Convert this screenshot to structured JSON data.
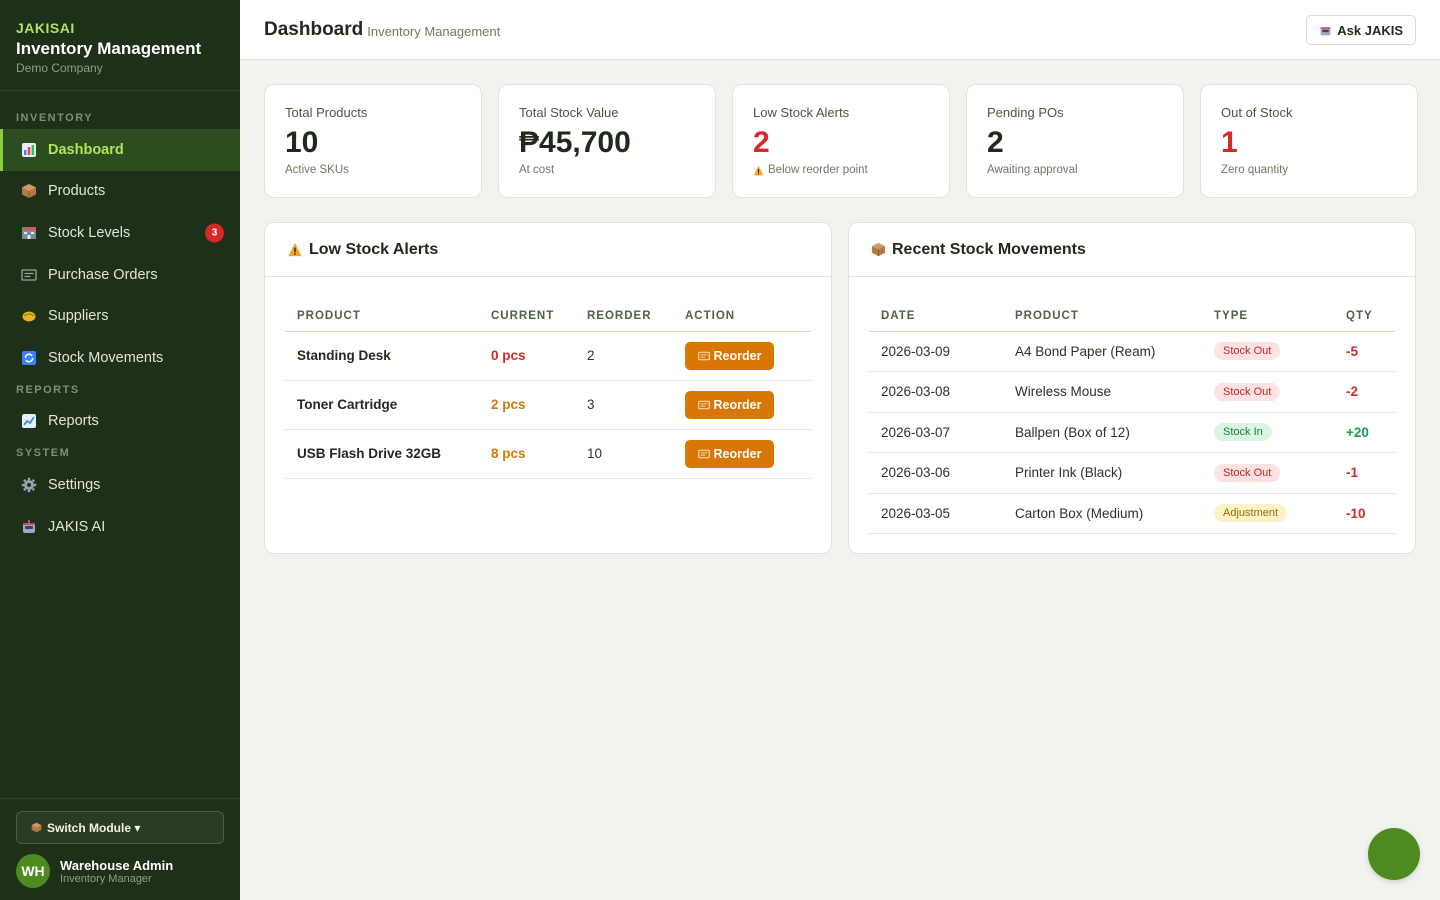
{
  "brand": {
    "tag": "JAKISAI",
    "title": "Inventory Management",
    "company": "Demo Company"
  },
  "sidebar": {
    "sections": {
      "inventory": "INVENTORY",
      "reports": "REPORTS",
      "system": "SYSTEM"
    },
    "items": [
      {
        "label": "Dashboard",
        "icon": "bar-chart-icon"
      },
      {
        "label": "Products",
        "icon": "package-icon"
      },
      {
        "label": "Stock Levels",
        "icon": "shelf-icon",
        "badge": "3"
      },
      {
        "label": "Purchase Orders",
        "icon": "order-icon"
      },
      {
        "label": "Suppliers",
        "icon": "handshake-icon"
      },
      {
        "label": "Stock Movements",
        "icon": "refresh-icon"
      },
      {
        "label": "Reports",
        "icon": "line-chart-icon"
      },
      {
        "label": "Settings",
        "icon": "gear-icon"
      },
      {
        "label": "JAKIS AI",
        "icon": "robot-icon"
      }
    ],
    "switch_module": "Switch Module ▾",
    "user": {
      "initials": "WH",
      "name": "Warehouse Admin",
      "role": "Inventory Manager"
    }
  },
  "header": {
    "title": "Dashboard",
    "subtitle": "Inventory Management",
    "ask_label": "Ask JAKIS"
  },
  "stats": [
    {
      "label": "Total Products",
      "value": "10",
      "sub": "Active SKUs"
    },
    {
      "label": "Total Stock Value",
      "value": "₱45,700",
      "sub": "At cost"
    },
    {
      "label": "Low Stock Alerts",
      "value": "2",
      "sub": "Below reorder point"
    },
    {
      "label": "Pending POs",
      "value": "2",
      "sub": "Awaiting approval"
    },
    {
      "label": "Out of Stock",
      "value": "1",
      "sub": "Zero quantity"
    }
  ],
  "low_stock": {
    "title": "Low Stock Alerts",
    "columns": [
      "PRODUCT",
      "CURRENT",
      "REORDER",
      "ACTION"
    ],
    "rows": [
      {
        "product": "Standing Desk",
        "current": "0 pcs",
        "reorder": "2",
        "action": "Reorder"
      },
      {
        "product": "Toner Cartridge",
        "current": "2 pcs",
        "reorder": "3",
        "action": "Reorder"
      },
      {
        "product": "USB Flash Drive 32GB",
        "current": "8 pcs",
        "reorder": "10",
        "action": "Reorder"
      }
    ]
  },
  "movements": {
    "title": "Recent Stock Movements",
    "columns": [
      "DATE",
      "PRODUCT",
      "TYPE",
      "QTY"
    ],
    "rows": [
      {
        "date": "2026-03-09",
        "product": "A4 Bond Paper (Ream)",
        "type": "Stock Out",
        "qty": "-5"
      },
      {
        "date": "2026-03-08",
        "product": "Wireless Mouse",
        "type": "Stock Out",
        "qty": "-2"
      },
      {
        "date": "2026-03-07",
        "product": "Ballpen (Box of 12)",
        "type": "Stock In",
        "qty": "+20"
      },
      {
        "date": "2026-03-06",
        "product": "Printer Ink (Black)",
        "type": "Stock Out",
        "qty": "-1"
      },
      {
        "date": "2026-03-05",
        "product": "Carton Box (Medium)",
        "type": "Adjustment",
        "qty": "-10"
      }
    ]
  },
  "colors": {
    "sidebar_bg": "#1e2f1a",
    "accent": "#b5e25f",
    "danger": "#d42a2a",
    "warning": "#d97706",
    "success": "#16a34a",
    "fab": "#4d8a1f"
  }
}
